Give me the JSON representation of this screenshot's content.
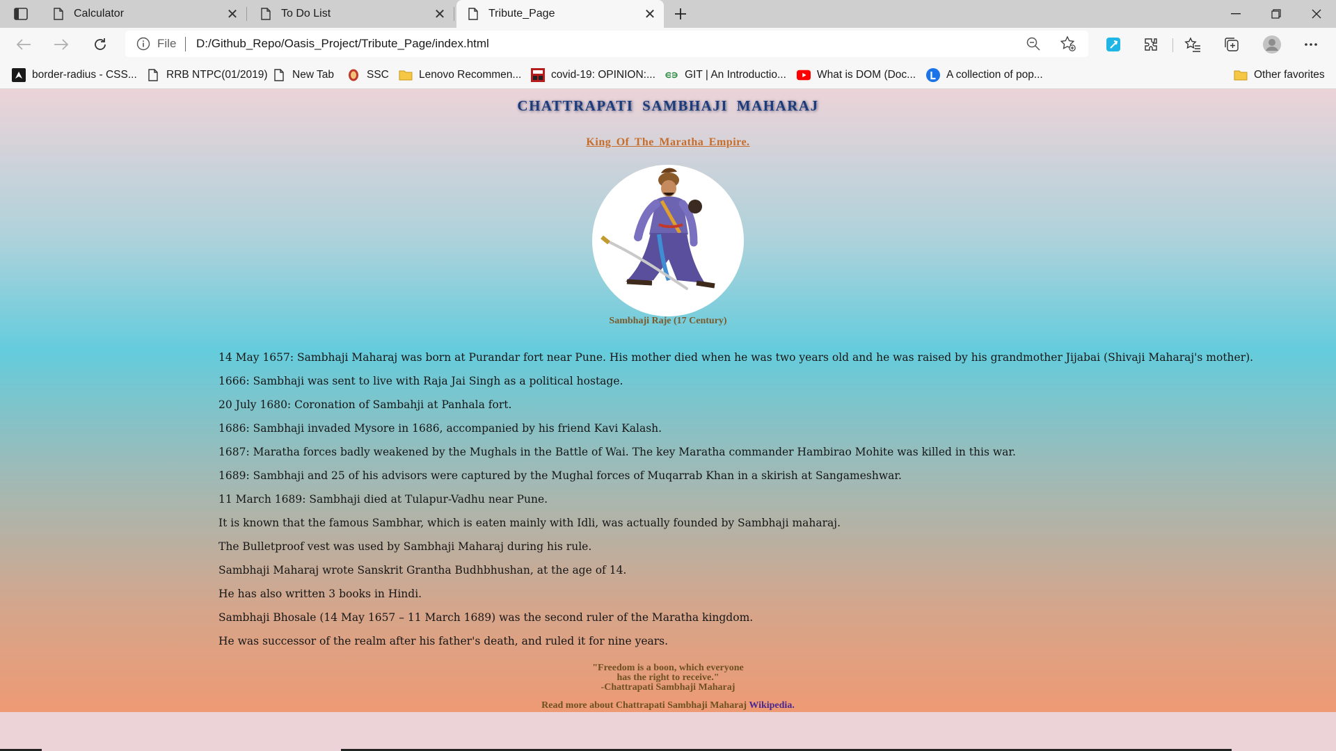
{
  "browser": {
    "tabs": [
      {
        "title": "Calculator",
        "active": false
      },
      {
        "title": "To Do List",
        "active": false
      },
      {
        "title": "Tribute_Page",
        "active": true
      }
    ],
    "address": {
      "scheme": "File",
      "url": "D:/Github_Repo/Oasis_Project/Tribute_Page/index.html"
    },
    "bookmarks": [
      {
        "label": "border-radius - CSS...",
        "icon": "bookmark-dark-icon"
      },
      {
        "label": "RRB NTPC(01/2019)",
        "icon": "page-icon"
      },
      {
        "label": "New Tab",
        "icon": "page-icon"
      },
      {
        "label": "SSC",
        "icon": "ssc-emblem-icon"
      },
      {
        "label": "Lenovo Recommen...",
        "icon": "folder-icon"
      },
      {
        "label": "covid-19: OPINION:...",
        "icon": "news-icon"
      },
      {
        "label": "GIT | An Introductio...",
        "icon": "gfg-icon"
      },
      {
        "label": "What is DOM (Doc...",
        "icon": "youtube-icon"
      },
      {
        "label": "A collection of pop...",
        "icon": "l-logo-icon"
      }
    ],
    "other_favorites": "Other favorites"
  },
  "page": {
    "title": "CHATTRAPATI SAMBHAJI MAHARAJ",
    "subtitle": "King Of The Maratha Empire.",
    "image_caption": "Sambhaji Raje (17 Century)",
    "facts": [
      "14 May 1657: Sambhaji Maharaj was born at Purandar fort near Pune. His mother died when he was two years old and he was raised by his grandmother Jijabai (Shivaji Maharaj's mother).",
      "1666: Sambhaji was sent to live with Raja Jai Singh as a political hostage.",
      "20 July 1680: Coronation of Sambahji at Panhala fort.",
      "1686: Sambhaji invaded Mysore in 1686, accompanied by his friend Kavi Kalash.",
      "1687: Maratha forces badly weakened by the Mughals in the Battle of Wai. The key Maratha commander Hambirao Mohite was killed in this war.",
      "1689: Sambhaji and 25 of his advisors were captured by the Mughal forces of Muqarrab Khan in a skirish at Sangameshwar.",
      "11 March 1689: Sambhaji died at Tulapur-Vadhu near Pune.",
      "It is known that the famous Sambhar, which is eaten mainly with Idli, was actually founded by Sambhaji maharaj.",
      "The Bulletproof vest was used by Sambhaji Maharaj during his rule.",
      "Sambhaji Maharaj wrote Sanskrit Grantha Budhbhushan, at the age of 14.",
      "He has also written 3 books in Hindi.",
      "Sambhaji Bhosale (14 May 1657 – 11 March 1689) was the second ruler of the Maratha kingdom.",
      "He was successor of the realm after his father's death, and ruled it for nine years."
    ],
    "quote": {
      "line1": "\"Freedom is a boon, which everyone",
      "line2": "has the right to receive.\"",
      "author": "-Chattrapati Sambhaji Maharaj"
    },
    "read_more_text": "Read more about Chattrapati Sambhaji Maharaj",
    "read_more_link": "Wikipedia."
  },
  "colors": {
    "title": "#1c3b7a",
    "subtitle": "#c76d2b",
    "link": "#4a2790",
    "edge_accent": "#1fb6e6"
  }
}
